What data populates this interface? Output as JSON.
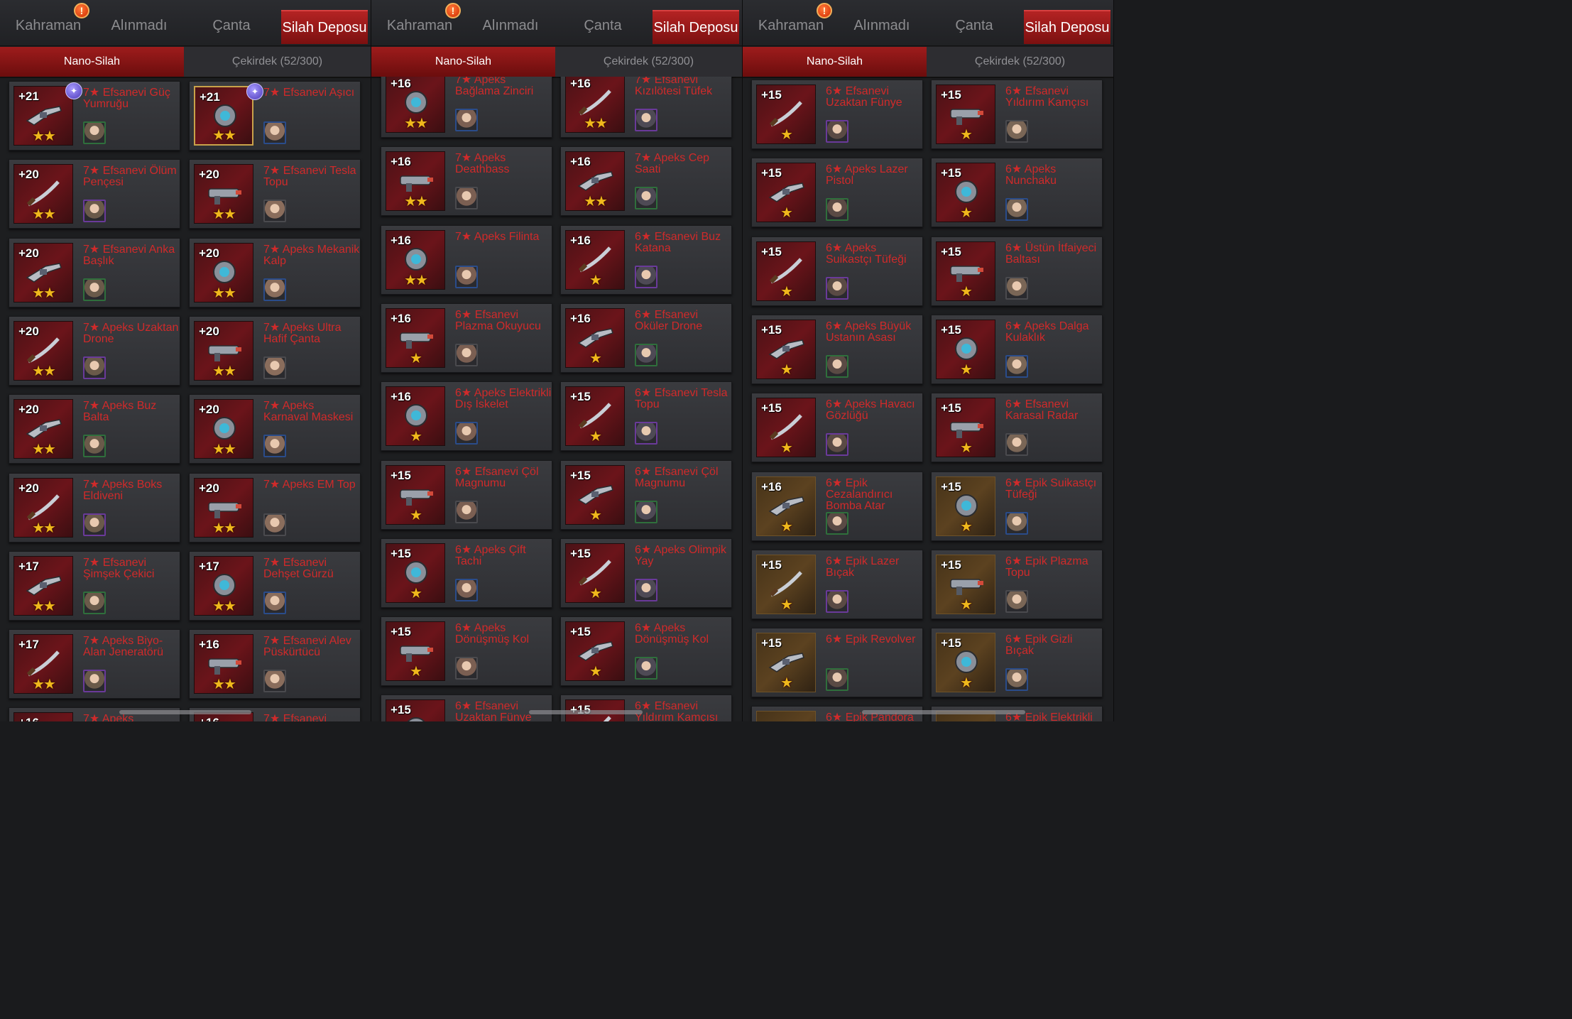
{
  "colors": {
    "accent_red": "#9e1c1c",
    "item_name": "#d02a2a",
    "star": "#f0b81c",
    "level_text": "#ffffff"
  },
  "icons": {
    "alert": "alert-icon",
    "orb": "orb-icon",
    "star": "star-icon",
    "portrait": "hero-portrait"
  },
  "panels": [
    {
      "tabs": [
        "Kahraman",
        "Alınmadı",
        "Çanta",
        "Silah Deposu"
      ],
      "active_tab": 3,
      "subtabs": [
        "Nano-Silah",
        "Çekirdek (52/300)"
      ],
      "active_subtab": 0,
      "items": [
        {
          "level": "+21",
          "name": "7★ Efsanevi Güç Yumruğu",
          "stars": 2,
          "frame": "red",
          "orb": true
        },
        {
          "level": "+21",
          "name": "7★ Efsanevi Aşıcı",
          "stars": 2,
          "frame": "gold",
          "orb": true
        },
        {
          "level": "+20",
          "name": "7★ Efsanevi Ölüm Pençesi",
          "stars": 2,
          "frame": "red"
        },
        {
          "level": "+20",
          "name": "7★ Efsanevi Tesla Topu",
          "stars": 2,
          "frame": "red"
        },
        {
          "level": "+20",
          "name": "7★ Efsanevi Anka Başlık",
          "stars": 2,
          "frame": "red"
        },
        {
          "level": "+20",
          "name": "7★ Apeks Mekanik Kalp",
          "stars": 2,
          "frame": "red"
        },
        {
          "level": "+20",
          "name": "7★ Apeks Uzaktan Drone",
          "stars": 2,
          "frame": "red"
        },
        {
          "level": "+20",
          "name": "7★ Apeks Ultra Hafif Çanta",
          "stars": 2,
          "frame": "red"
        },
        {
          "level": "+20",
          "name": "7★ Apeks Buz Balta",
          "stars": 2,
          "frame": "red"
        },
        {
          "level": "+20",
          "name": "7★ Apeks Karnaval Maskesi",
          "stars": 2,
          "frame": "red"
        },
        {
          "level": "+20",
          "name": "7★ Apeks Boks Eldiveni",
          "stars": 2,
          "frame": "red"
        },
        {
          "level": "+20",
          "name": "7★ Apeks EM Top",
          "stars": 2,
          "frame": "red"
        },
        {
          "level": "+17",
          "name": "7★ Efsanevi Şimşek Çekici",
          "stars": 2,
          "frame": "red"
        },
        {
          "level": "+17",
          "name": "7★ Efsanevi Dehşet Gürzü",
          "stars": 2,
          "frame": "red"
        },
        {
          "level": "+17",
          "name": "7★ Apeks Biyo-Alan Jeneratörü",
          "stars": 2,
          "frame": "red"
        },
        {
          "level": "+16",
          "name": "7★ Efsanevi Alev Püskürtücü",
          "stars": 2,
          "frame": "red"
        },
        {
          "level": "+16",
          "name": "7★ Apeks",
          "stars": 2,
          "frame": "red"
        },
        {
          "level": "+16",
          "name": "7★ Efsanevi",
          "stars": 2,
          "frame": "red"
        }
      ]
    },
    {
      "tabs": [
        "Kahraman",
        "Alınmadı",
        "Çanta",
        "Silah Deposu"
      ],
      "active_tab": 3,
      "subtabs": [
        "Nano-Silah",
        "Çekirdek (52/300)"
      ],
      "active_subtab": 0,
      "items": [
        {
          "level": "+16",
          "name": "7★ Apeks Bağlama Zinciri",
          "stars": 2,
          "frame": "red"
        },
        {
          "level": "+16",
          "name": "7★ Efsanevi Kızılötesi Tüfek",
          "stars": 2,
          "frame": "red"
        },
        {
          "level": "+16",
          "name": "7★ Apeks Deathbass",
          "stars": 2,
          "frame": "red"
        },
        {
          "level": "+16",
          "name": "7★ Apeks Cep Saati",
          "stars": 2,
          "frame": "red"
        },
        {
          "level": "+16",
          "name": "7★ Apeks Filinta",
          "stars": 2,
          "frame": "red"
        },
        {
          "level": "+16",
          "name": "6★ Efsanevi Buz Katana",
          "stars": 1,
          "frame": "red"
        },
        {
          "level": "+16",
          "name": "6★ Efsanevi Plazma Okuyucu",
          "stars": 1,
          "frame": "red"
        },
        {
          "level": "+16",
          "name": "6★ Efsanevi Oküler Drone",
          "stars": 1,
          "frame": "red"
        },
        {
          "level": "+16",
          "name": "6★ Apeks Elektrikli Dış İskelet",
          "stars": 1,
          "frame": "red"
        },
        {
          "level": "+15",
          "name": "6★ Efsanevi Tesla Topu",
          "stars": 1,
          "frame": "red"
        },
        {
          "level": "+15",
          "name": "6★ Efsanevi Çöl Magnumu",
          "stars": 1,
          "frame": "red"
        },
        {
          "level": "+15",
          "name": "6★ Efsanevi Çöl Magnumu",
          "stars": 1,
          "frame": "red"
        },
        {
          "level": "+15",
          "name": "6★ Apeks Çift Tachi",
          "stars": 1,
          "frame": "red"
        },
        {
          "level": "+15",
          "name": "6★ Apeks Olimpik Yay",
          "stars": 1,
          "frame": "red"
        },
        {
          "level": "+15",
          "name": "6★ Apeks Dönüşmüş Kol",
          "stars": 1,
          "frame": "red"
        },
        {
          "level": "+15",
          "name": "6★ Apeks Dönüşmüş Kol",
          "stars": 1,
          "frame": "red"
        },
        {
          "level": "+15",
          "name": "6★ Efsanevi Uzaktan Fünye",
          "stars": 1,
          "frame": "red"
        },
        {
          "level": "+15",
          "name": "6★ Efsanevi Yıldırım Kamçısı",
          "stars": 1,
          "frame": "red"
        }
      ]
    },
    {
      "tabs": [
        "Kahraman",
        "Alınmadı",
        "Çanta",
        "Silah Deposu"
      ],
      "active_tab": 3,
      "subtabs": [
        "Nano-Silah",
        "Çekirdek (52/300)"
      ],
      "active_subtab": 0,
      "items": [
        {
          "level": "+15",
          "name": "6★ Efsanevi Uzaktan Fünye",
          "stars": 1,
          "frame": "red"
        },
        {
          "level": "+15",
          "name": "6★ Efsanevi Yıldırım Kamçısı",
          "stars": 1,
          "frame": "red"
        },
        {
          "level": "+15",
          "name": "6★ Apeks Lazer Pistol",
          "stars": 1,
          "frame": "red"
        },
        {
          "level": "+15",
          "name": "6★ Apeks Nunchaku",
          "stars": 1,
          "frame": "red"
        },
        {
          "level": "+15",
          "name": "6★ Apeks Suikastçı Tüfeği",
          "stars": 1,
          "frame": "red"
        },
        {
          "level": "+15",
          "name": "6★ Üstün İtfaiyeci Baltası",
          "stars": 1,
          "frame": "red"
        },
        {
          "level": "+15",
          "name": "6★ Apeks Büyük Ustanın Asası",
          "stars": 1,
          "frame": "red"
        },
        {
          "level": "+15",
          "name": "6★ Apeks Dalga Kulaklık",
          "stars": 1,
          "frame": "red"
        },
        {
          "level": "+15",
          "name": "6★ Apeks Havacı Gözlüğü",
          "stars": 1,
          "frame": "red"
        },
        {
          "level": "+15",
          "name": "6★ Efsanevi Karasal Radar",
          "stars": 1,
          "frame": "red"
        },
        {
          "level": "+16",
          "name": "6★ Epik Cezalandırıcı Bomba Atar",
          "stars": 1,
          "frame": "epic"
        },
        {
          "level": "+15",
          "name": "6★ Epik Suikastçı Tüfeği",
          "stars": 1,
          "frame": "epic"
        },
        {
          "level": "+15",
          "name": "6★ Epik Lazer Bıçak",
          "stars": 1,
          "frame": "epic"
        },
        {
          "level": "+15",
          "name": "6★ Epik Plazma Topu",
          "stars": 1,
          "frame": "epic"
        },
        {
          "level": "+15",
          "name": "6★ Epik Revolver",
          "stars": 1,
          "frame": "epic"
        },
        {
          "level": "+15",
          "name": "6★ Epik Gizli Bıçak",
          "stars": 1,
          "frame": "epic"
        },
        {
          "level": "",
          "name": "6★ Epik Pandora",
          "stars": 1,
          "frame": "epic"
        },
        {
          "level": "",
          "name": "6★ Epik Elektrikli",
          "stars": 1,
          "frame": "epic"
        }
      ]
    }
  ]
}
